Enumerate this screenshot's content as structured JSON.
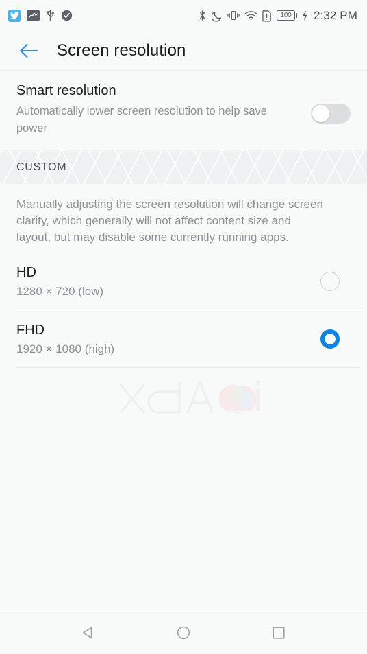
{
  "status_bar": {
    "left_icons": [
      {
        "name": "twitter-app-icon",
        "glyph": "bird"
      },
      {
        "name": "stats-chart-icon",
        "glyph": "chart"
      },
      {
        "name": "usb-icon",
        "glyph": "usb"
      },
      {
        "name": "checkmark-circle-icon",
        "glyph": "check"
      }
    ],
    "right_icons": [
      {
        "name": "bluetooth-icon"
      },
      {
        "name": "do-not-disturb-moon-icon"
      },
      {
        "name": "vibrate-icon"
      },
      {
        "name": "wifi-icon"
      },
      {
        "name": "sim-card-alert-icon"
      },
      {
        "name": "battery-icon"
      },
      {
        "name": "charging-bolt-icon"
      }
    ],
    "battery_level": "100",
    "time": "2:32 PM"
  },
  "app_bar": {
    "back_label": "back-arrow",
    "title": "Screen resolution"
  },
  "smart_resolution": {
    "title": "Smart resolution",
    "subtitle": "Automatically lower screen resolution to help save power",
    "toggle_state": "off"
  },
  "custom_section": {
    "header": "CUSTOM",
    "description": "Manually adjusting the screen resolution will change screen clarity, which generally will not affect content size and layout, but may disable some currently running apps.",
    "options": [
      {
        "title": "HD",
        "subtitle": "1280 × 720 (low)",
        "selected": false
      },
      {
        "title": "FHD",
        "subtitle": "1920 × 1080 (high)",
        "selected": true
      }
    ]
  },
  "watermark": {
    "text": "xda"
  },
  "nav_bar": {
    "buttons": [
      {
        "name": "nav-back-button",
        "shape": "triangle"
      },
      {
        "name": "nav-home-button",
        "shape": "circle"
      },
      {
        "name": "nav-recents-button",
        "shape": "square"
      }
    ]
  },
  "colors": {
    "accent_blue": "#0b84e2",
    "title_text": "#1d1d1d",
    "secondary_text": "#8d9296",
    "background": "#f8f9f9",
    "band": "#eff0f1"
  }
}
